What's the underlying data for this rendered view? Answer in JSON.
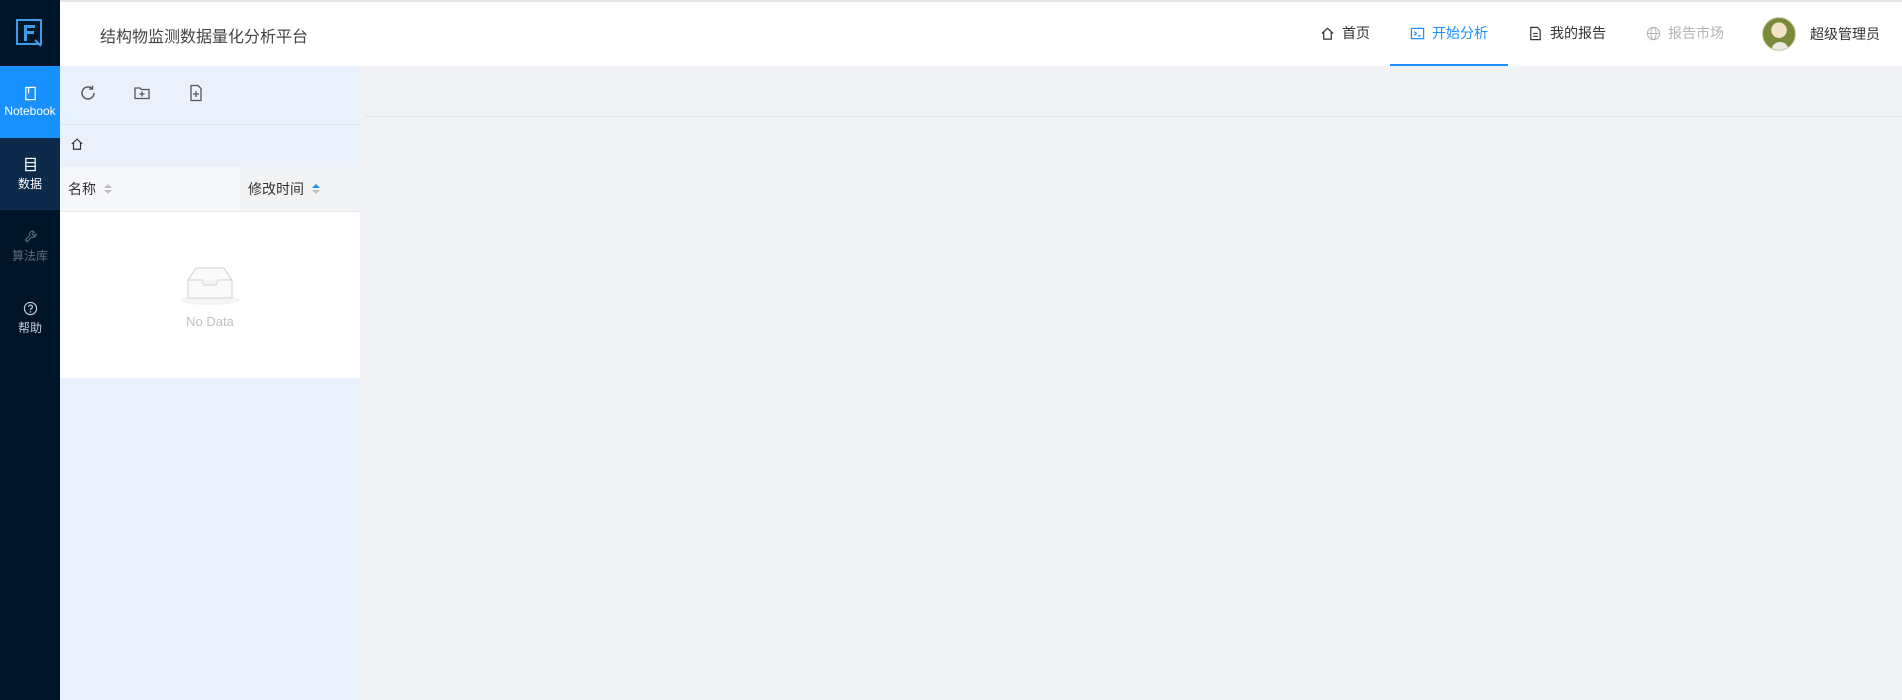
{
  "app": {
    "title": "结构物监测数据量化分析平台"
  },
  "rail": {
    "items": [
      {
        "label": "Notebook"
      },
      {
        "label": "数据"
      },
      {
        "label": "算法库"
      },
      {
        "label": "帮助"
      }
    ]
  },
  "nav": {
    "items": [
      {
        "label": "首页"
      },
      {
        "label": "开始分析"
      },
      {
        "label": "我的报告"
      },
      {
        "label": "报告市场"
      }
    ],
    "user": "超级管理员"
  },
  "table": {
    "columns": [
      {
        "label": "名称"
      },
      {
        "label": "修改时间"
      }
    ],
    "empty_text": "No Data"
  },
  "colors": {
    "primary": "#1890ff",
    "rail_bg": "#011529",
    "panel_bg": "#e9f1fd"
  }
}
